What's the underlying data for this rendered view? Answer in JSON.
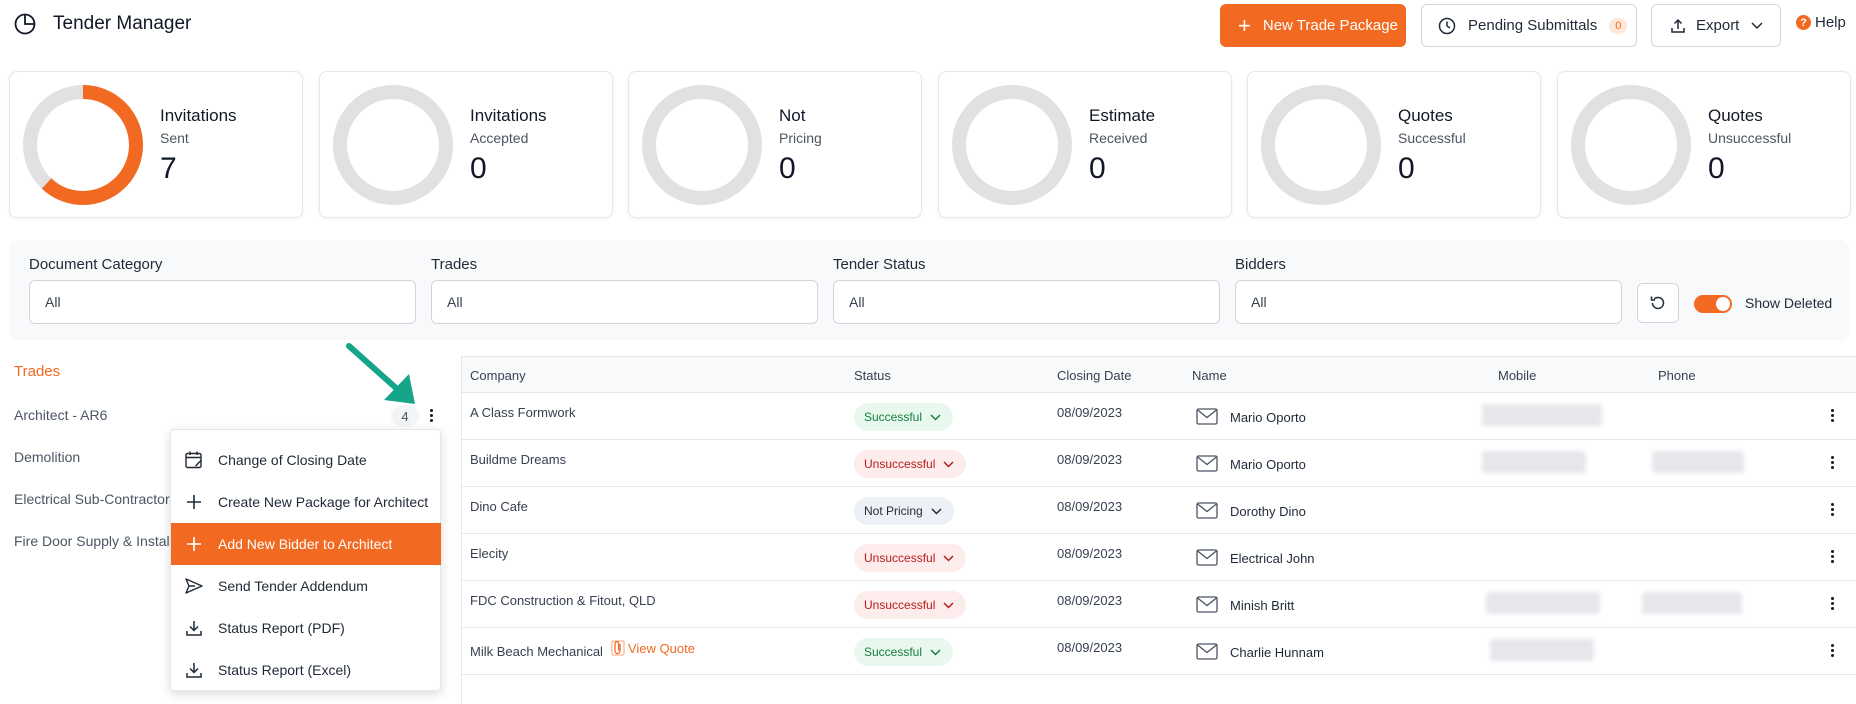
{
  "app": {
    "title": "Tender Manager"
  },
  "header": {
    "new_trade_package": "New Trade Package",
    "pending_submittals": "Pending Submittals",
    "pending_count": "0",
    "export": "Export",
    "help": "Help"
  },
  "colors": {
    "accent": "#f26a21",
    "ring_empty": "#e1e1e1"
  },
  "stats": [
    {
      "title": "Invitations",
      "subtitle": "Sent",
      "value": "7",
      "fill": 0.62
    },
    {
      "title": "Invitations",
      "subtitle": "Accepted",
      "value": "0",
      "fill": 0
    },
    {
      "title": "Not",
      "subtitle": "Pricing",
      "value": "0",
      "fill": 0
    },
    {
      "title": "Estimate",
      "subtitle": "Received",
      "value": "0",
      "fill": 0
    },
    {
      "title": "Quotes",
      "subtitle": "Successful",
      "value": "0",
      "fill": 0
    },
    {
      "title": "Quotes",
      "subtitle": "Unsuccessful",
      "value": "0",
      "fill": 0
    }
  ],
  "filters": {
    "document_category": {
      "label": "Document Category",
      "value": "All"
    },
    "trades": {
      "label": "Trades",
      "value": "All"
    },
    "tender_status": {
      "label": "Tender Status",
      "value": "All"
    },
    "bidders": {
      "label": "Bidders",
      "value": "All"
    },
    "show_deleted": "Show Deleted"
  },
  "trades": {
    "title": "Trades",
    "items": [
      {
        "label": "Architect - AR6",
        "count": "4"
      },
      {
        "label": "Demolition"
      },
      {
        "label": "Electrical Sub-Contractor"
      },
      {
        "label": "Fire Door Supply & Install"
      }
    ]
  },
  "context_menu": {
    "items": [
      {
        "label": "Change of Closing Date",
        "icon": "calendar-edit-icon"
      },
      {
        "label": "Create New Package for Architect",
        "icon": "plus-icon"
      },
      {
        "label": "Add New Bidder to Architect",
        "icon": "plus-icon",
        "active": true
      },
      {
        "label": "Send Tender Addendum",
        "icon": "send-icon"
      },
      {
        "label": "Status Report (PDF)",
        "icon": "download-icon"
      },
      {
        "label": "Status Report (Excel)",
        "icon": "download-icon"
      }
    ]
  },
  "table": {
    "columns": {
      "company": "Company",
      "status": "Status",
      "closing_date": "Closing Date",
      "name": "Name",
      "mobile": "Mobile",
      "phone": "Phone"
    },
    "view_quote": "View Quote",
    "rows": [
      {
        "company": "A Class Formwork",
        "status": "Successful",
        "closing": "08/09/2023",
        "name": "Mario Oporto"
      },
      {
        "company": "Buildme Dreams",
        "status": "Unsuccessful",
        "closing": "08/09/2023",
        "name": "Mario Oporto"
      },
      {
        "company": "Dino Cafe",
        "status": "Not Pricing",
        "closing": "08/09/2023",
        "name": "Dorothy Dino"
      },
      {
        "company": "Elecity",
        "status": "Unsuccessful",
        "closing": "08/09/2023",
        "name": "Electrical John"
      },
      {
        "company": "FDC Construction & Fitout, QLD",
        "status": "Unsuccessful",
        "closing": "08/09/2023",
        "name": "Minish Britt"
      },
      {
        "company": "Milk Beach Mechanical",
        "status": "Successful",
        "closing": "08/09/2023",
        "name": "Charlie Hunnam"
      }
    ]
  }
}
